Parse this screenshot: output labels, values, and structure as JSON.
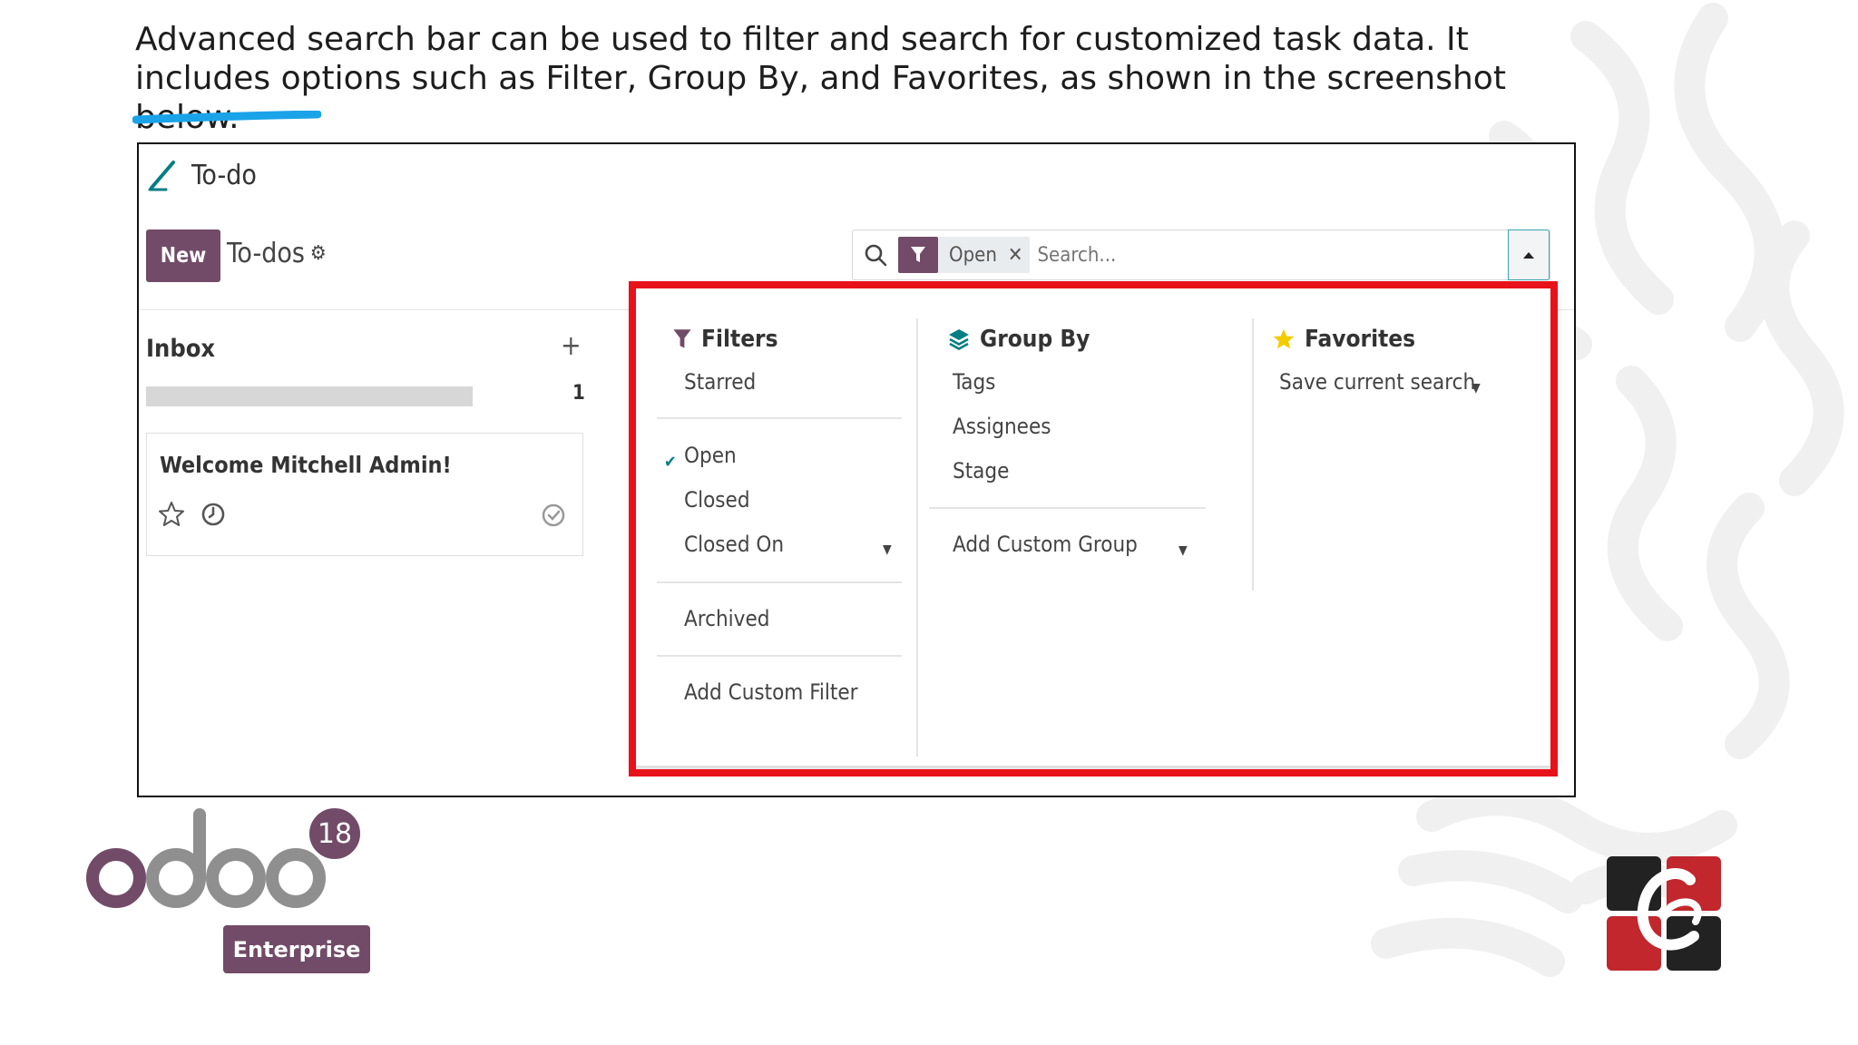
{
  "intro_text": "Advanced search bar can be used to filter and search for customized task data. It includes options such as Filter, Group By, and Favorites, as shown in the screenshot below.",
  "app": {
    "title": "To-do",
    "new_label": "New",
    "breadcrumb": "To-dos"
  },
  "search": {
    "facet_value": "Open",
    "facet_remove": "✕",
    "placeholder": "Search..."
  },
  "kanban": {
    "column_title": "Inbox",
    "add_symbol": "+",
    "count": "1",
    "progress_fraction": 1.0,
    "card_title": "Welcome Mitchell Admin!"
  },
  "dropdown": {
    "filters": {
      "title": "Filters",
      "items": [
        "Starred",
        "Open",
        "Closed",
        "Closed On",
        "Archived",
        "Add Custom Filter"
      ],
      "checked": "Open"
    },
    "group_by": {
      "title": "Group By",
      "items": [
        "Tags",
        "Assignees",
        "Stage",
        "Add Custom Group"
      ]
    },
    "favorites": {
      "title": "Favorites",
      "items": [
        "Save current search"
      ]
    }
  },
  "branding": {
    "odoo_version": "18",
    "edition": "Enterprise"
  },
  "colors": {
    "brand_purple": "#714B67",
    "highlight_red": "#e8121b",
    "teal": "#017e84",
    "accent_blue": "#1aa3e8"
  }
}
